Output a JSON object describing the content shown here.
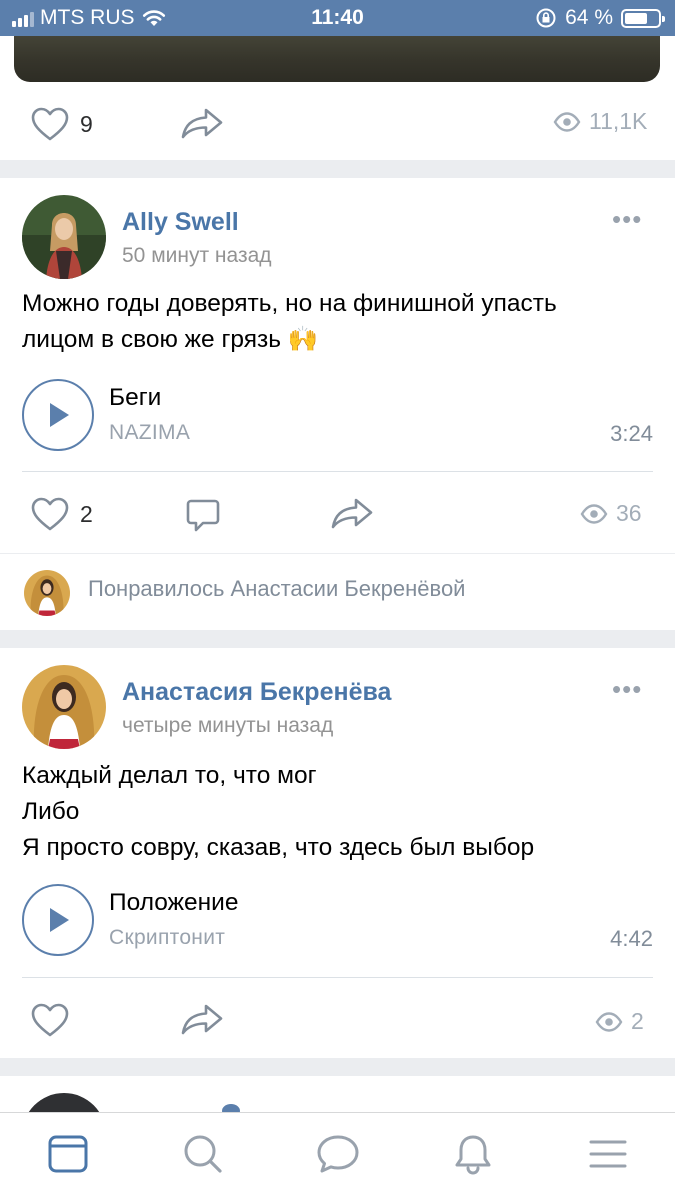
{
  "status_bar": {
    "carrier": "MTS RUS",
    "time": "11:40",
    "battery": "64 %"
  },
  "colors": {
    "accent": "#4a76a8",
    "status_bar_bg": "#5b7fac",
    "muted": "#818c99",
    "background": "#ebedf0"
  },
  "post1": {
    "likes": "9",
    "views": "11,1K"
  },
  "post2": {
    "author": "Ally Swell",
    "time": "50 минут назад",
    "text_lines": [
      "Можно годы доверять, но на финишной упасть",
      "лицом  в свою же грязь 🙌"
    ],
    "audio": {
      "title": "Беги",
      "artist": "NAZIMA",
      "duration": "3:24"
    },
    "likes": "2",
    "views": "36"
  },
  "liked_by": {
    "text": "Понравилось Анастасии Бекренёвой"
  },
  "post3": {
    "author": "Анастасия Бекренёва",
    "time": "четыре минуты назад",
    "text_lines": [
      "Каждый делал то, что мог",
      "Либо",
      "Я просто совру, сказав, что здесь был выбор"
    ],
    "audio": {
      "title": "Положение",
      "artist": "Скриптонит",
      "duration": "4:42"
    },
    "views": "2"
  },
  "tabbar": {
    "items": [
      {
        "icon": "news-icon",
        "active": true
      },
      {
        "icon": "search-icon",
        "active": false
      },
      {
        "icon": "messages-icon",
        "active": false
      },
      {
        "icon": "notifications-icon",
        "active": false
      },
      {
        "icon": "menu-icon",
        "active": false
      }
    ]
  }
}
